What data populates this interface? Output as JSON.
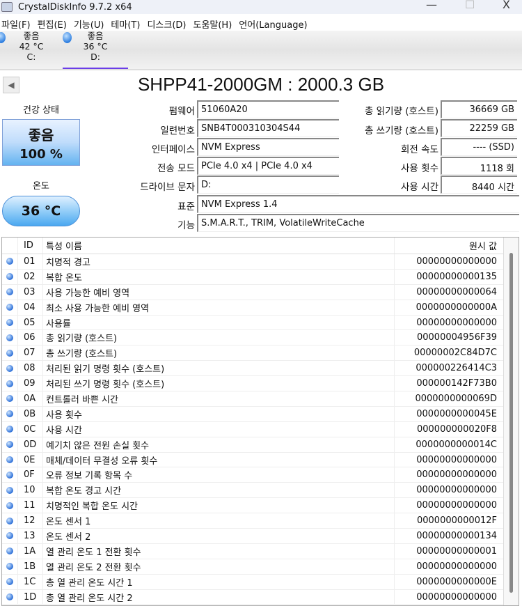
{
  "window": {
    "title": "CrystalDiskInfo 9.7.2 x64",
    "minimize": "—",
    "maximize": "☐",
    "close": "X"
  },
  "menu": [
    "파일(F)",
    "편집(E)",
    "기능(U)",
    "테마(T)",
    "디스크(D)",
    "도움말(H)",
    "언어(Language)"
  ],
  "drives": [
    {
      "status": "좋음",
      "temp": "42 °C",
      "letter": "C:"
    },
    {
      "status": "좋음",
      "temp": "36 °C",
      "letter": "D:"
    }
  ],
  "model": "SHPP41-2000GM : 2000.3 GB",
  "health": {
    "label": "건강 상태",
    "status": "좋음",
    "percent": "100 %"
  },
  "temperature": {
    "label": "온도",
    "value": "36 °C"
  },
  "info": {
    "firmware": {
      "label": "펌웨어",
      "value": "51060A20"
    },
    "serial": {
      "label": "일련번호",
      "value": "SNB4T000310304S44"
    },
    "interface": {
      "label": "인터페이스",
      "value": "NVM Express"
    },
    "transfer": {
      "label": "전송 모드",
      "value": "PCIe 4.0 x4 | PCIe 4.0 x4"
    },
    "drive_letter": {
      "label": "드라이브 문자",
      "value": "D:"
    },
    "standard": {
      "label": "표준",
      "value": "NVM Express 1.4"
    },
    "features": {
      "label": "기능",
      "value": "S.M.A.R.T., TRIM, VolatileWriteCache"
    },
    "reads": {
      "label": "총 읽기량 (호스트)",
      "value": "36669 GB"
    },
    "writes": {
      "label": "총 쓰기량 (호스트)",
      "value": "22259 GB"
    },
    "rotation": {
      "label": "회전 속도",
      "value": "---- (SSD)"
    },
    "power_count": {
      "label": "사용 횟수",
      "value": "1118 회"
    },
    "power_hours": {
      "label": "사용 시간",
      "value": "8440 시간"
    }
  },
  "smart": {
    "headers": {
      "id": "ID",
      "name": "특성 이름",
      "raw": "원시 값"
    },
    "rows": [
      {
        "id": "01",
        "name": "치명적 경고",
        "raw": "00000000000000"
      },
      {
        "id": "02",
        "name": "복합 온도",
        "raw": "00000000000135"
      },
      {
        "id": "03",
        "name": "사용 가능한 예비 영역",
        "raw": "00000000000064"
      },
      {
        "id": "04",
        "name": "최소 사용 가능한 예비 영역",
        "raw": "0000000000000A"
      },
      {
        "id": "05",
        "name": "사용률",
        "raw": "00000000000000"
      },
      {
        "id": "06",
        "name": "총 읽기량 (호스트)",
        "raw": "00000004956F39"
      },
      {
        "id": "07",
        "name": "총 쓰기량 (호스트)",
        "raw": "00000002C84D7C"
      },
      {
        "id": "08",
        "name": "처리된 읽기 명령 횟수 (호스트)",
        "raw": "000000226414C3"
      },
      {
        "id": "09",
        "name": "처리된 쓰기 명령 횟수 (호스트)",
        "raw": "000000142F73B0"
      },
      {
        "id": "0A",
        "name": "컨트롤러 바쁜 시간",
        "raw": "0000000000069D"
      },
      {
        "id": "0B",
        "name": "사용 횟수",
        "raw": "0000000000045E"
      },
      {
        "id": "0C",
        "name": "사용 시간",
        "raw": "000000000020F8"
      },
      {
        "id": "0D",
        "name": "예기치 않은 전원 손실 횟수",
        "raw": "0000000000014C"
      },
      {
        "id": "0E",
        "name": "매체/데이터 무결성 오류 횟수",
        "raw": "00000000000000"
      },
      {
        "id": "0F",
        "name": "오류 정보 기록 항목 수",
        "raw": "00000000000000"
      },
      {
        "id": "10",
        "name": "복합 온도 경고 시간",
        "raw": "00000000000000"
      },
      {
        "id": "11",
        "name": "치명적인 복합 온도 시간",
        "raw": "00000000000000"
      },
      {
        "id": "12",
        "name": "온도 센서 1",
        "raw": "0000000000012F"
      },
      {
        "id": "13",
        "name": "온도 센서 2",
        "raw": "00000000000134"
      },
      {
        "id": "1A",
        "name": "열 관리 온도 1 전환 횟수",
        "raw": "00000000000001"
      },
      {
        "id": "1B",
        "name": "열 관리 온도 2 전환 횟수",
        "raw": "00000000000000"
      },
      {
        "id": "1C",
        "name": "총 열 관리 온도 시간 1",
        "raw": "0000000000000E"
      },
      {
        "id": "1D",
        "name": "총 열 관리 온도 시간 2",
        "raw": "00000000000000"
      }
    ]
  }
}
